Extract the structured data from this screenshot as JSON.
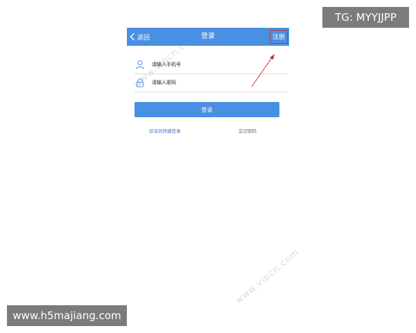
{
  "overlay": {
    "tg_text": "TG: MYYJJPP",
    "site_text": "www.h5majiang.com",
    "watermark_text": "www.vipcn.com"
  },
  "navbar": {
    "back_label": "返回",
    "title": "登录",
    "register_label": "注册",
    "color": "#4a90e2"
  },
  "form": {
    "phone_placeholder": "请输入手机号",
    "password_placeholder": "请输入密码",
    "login_label": "登录"
  },
  "links": {
    "quick_login": "验证码快捷登录",
    "forgot_password": "忘记密码"
  },
  "icons": {
    "back": "chevron-left-icon",
    "phone": "user-icon",
    "password": "lock-icon"
  },
  "annotation": {
    "arrow_color": "#c0392b"
  }
}
